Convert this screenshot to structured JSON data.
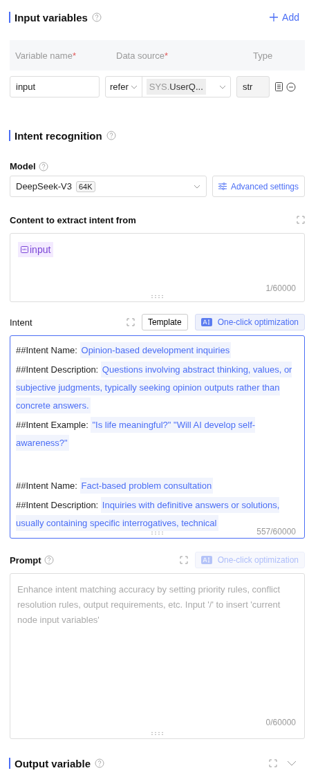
{
  "input_variables": {
    "title": "Input variables",
    "add_label": "Add",
    "columns": [
      {
        "label": "Variable name",
        "required_mark": "*"
      },
      {
        "label": "Data source",
        "required_mark": "*"
      },
      {
        "label": "Type"
      }
    ],
    "rows": [
      {
        "name": "input",
        "source_mode": "refer",
        "source_prefix": "SYS.",
        "source_value": "UserQ...",
        "type": "str"
      }
    ]
  },
  "intent_recognition": {
    "title": "Intent recognition",
    "model": {
      "label": "Model",
      "value": "DeepSeek-V3",
      "badge": "64K",
      "advanced_label": "Advanced settings"
    },
    "content": {
      "label": "Content to extract intent from",
      "tag": "input",
      "counter": "1/60000"
    },
    "intent": {
      "label": "Intent",
      "template_label": "Template",
      "optimize": {
        "label": "One-click optimization",
        "disabled": false
      },
      "groups": [
        {
          "entries": [
            {
              "label": "##Intent Name:",
              "value": "Opinion-based development inquiries"
            },
            {
              "label": "##Intent Description:",
              "value": "Questions involving abstract thinking, values, or subjective judgments, typically seeking opinion outputs rather than concrete answers."
            },
            {
              "label": "##Intent Example:",
              "value": "\"Is life meaningful?\" \"Will AI develop self-awareness?\""
            }
          ]
        },
        {
          "entries": [
            {
              "label": "##Intent Name:",
              "value": "Fact-based problem consultation"
            },
            {
              "label": "##Intent Description:",
              "value": "Inquiries with definitive answers or solutions, usually containing specific interrogatives, technical"
            }
          ]
        }
      ],
      "counter": "557/60000"
    },
    "prompt": {
      "label": "Prompt",
      "optimize": {
        "label": "One-click optimization",
        "disabled": true
      },
      "placeholder": "Enhance intent matching accuracy by setting priority rules, conflict resolution rules, output requirements, etc. Input '/' to insert 'current node input variables'",
      "counter": "0/60000"
    }
  },
  "output_variable": {
    "title": "Output variable"
  }
}
